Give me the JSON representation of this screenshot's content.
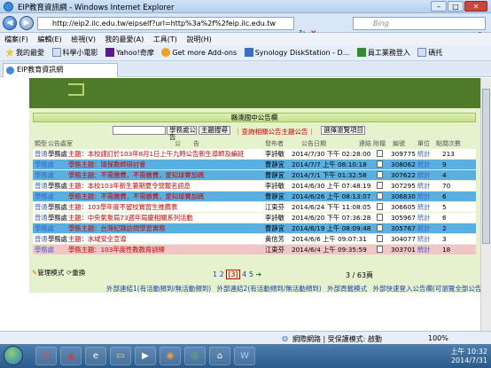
{
  "window": {
    "title": "EIP教育資訊網 - Windows Internet Explorer",
    "minimize": "–",
    "maximize": "□",
    "close": "✕"
  },
  "address": {
    "url": "http://eip2.ilc.edu.tw/eipself?url=http%3a%2f%2feip.ilc.edu.tw",
    "search_placeholder": "Bing"
  },
  "menu": [
    "檔案(F)",
    "編輯(E)",
    "檢視(V)",
    "我的最愛(A)",
    "工具(T)",
    "說明(H)"
  ],
  "favorites": [
    "我的最愛",
    "科學小電影",
    "Yahoo!奇摩",
    "Get more Add-ons",
    "Synology DiskStation - D...",
    "員工業務登入",
    "碼托"
  ],
  "tab": {
    "label": "EIP教育資訊網"
  },
  "board": {
    "title": "縣澳國中公告欄",
    "category_select": "學務處公告",
    "search_button": "主題搜尋",
    "important_link": "｜查詢相關公告主題公告｜",
    "view_select": "選擇瀏覽項目",
    "columns": {
      "type": "類型",
      "unit": "公告處室",
      "subject": "公　　告",
      "publisher": "發布者",
      "date": "公告日期",
      "link": "連結",
      "attach": "附檔",
      "code": "編號",
      "unit2": "單位",
      "clicks": "點閱次數"
    }
  },
  "rows": [
    {
      "type": "普通",
      "unit": "學務處",
      "subject": "主題：本校謹訂於103年8月1日上午九時公告新生導師及編班",
      "publisher": "李詩敏",
      "date": "2014/7/30 下午 02:28:00",
      "code": "309775",
      "stat": "統計",
      "clicks": "213",
      "style": "white"
    },
    {
      "type": "學務處",
      "unit": "",
      "subject": "學務主題：環保教師研討會",
      "publisher": "曹靜宜",
      "date": "2014/7/7 上午 08:10:18",
      "code": "308062",
      "stat": "統計",
      "clicks": "9",
      "style": "blue"
    },
    {
      "type": "學務處",
      "unit": "",
      "subject": "學務主題：不需繳費，不需繳費，愛知球賽加碼",
      "publisher": "曹靜宜",
      "date": "2014/7/1 下午 01:32:58",
      "code": "307622",
      "stat": "統計",
      "clicks": "4",
      "style": "blue"
    },
    {
      "type": "普通",
      "unit": "學務處",
      "subject": "主題：本校103年新生暑期夏令營報名訊息",
      "publisher": "李詩敏",
      "date": "2014/6/30 上午 07:48:19",
      "code": "307295",
      "stat": "統計",
      "clicks": "70",
      "style": "white"
    },
    {
      "type": "學務處",
      "unit": "",
      "subject": "學務主題：不需繳費，不需繳費，愛知球賽加碼",
      "publisher": "曹靜宜",
      "date": "2014/6/26 上午 08:13:07",
      "code": "306830",
      "stat": "統計",
      "clicks": "6",
      "style": "blue"
    },
    {
      "type": "普通",
      "unit": "學務處",
      "subject": "主題：103學年度不留校實習生推薦表",
      "publisher": "江東芬",
      "date": "2014/6/24 下午 11:08:05",
      "code": "306605",
      "stat": "統計",
      "clicks": "5",
      "style": "white"
    },
    {
      "type": "普通",
      "unit": "學務處",
      "subject": "主題：中央氣象局73週年局慶相關系列活動",
      "publisher": "李詩敏",
      "date": "2014/6/20 下午 07:36:28",
      "code": "305967",
      "stat": "統計",
      "clicks": "6",
      "style": "white"
    },
    {
      "type": "學務處",
      "unit": "",
      "subject": "學務主題：台灣紀錄訪問學習實務",
      "publisher": "曹靜宜",
      "date": "2014/6/19 上午 08:09:48",
      "code": "305767",
      "stat": "統計",
      "clicks": "2",
      "style": "blue"
    },
    {
      "type": "普通",
      "unit": "學務處",
      "subject": "主題：水域安全宣導",
      "publisher": "黃信芳",
      "date": "2014/6/6 上午 09:07:31",
      "code": "304077",
      "stat": "統計",
      "clicks": "3",
      "style": "white"
    },
    {
      "type": "學務處",
      "unit": "",
      "subject": "學務主題：103年度性教教育訓練",
      "publisher": "江東芬",
      "date": "2014/6/4 上午 09:35:59",
      "code": "303701",
      "stat": "統計",
      "clicks": "18",
      "style": "pink"
    }
  ],
  "pager": {
    "pages": [
      "1",
      "2",
      "[3]",
      "4",
      "5"
    ],
    "total": "3 / 63頁",
    "manage": "管理模式",
    "update": "重換"
  },
  "footer": {
    "links": [
      "外部連結1(有活動頻到/無活動頻到)",
      "外部連結2(有活動頻到/無活動頻到)",
      "外部頁籤模式",
      "外部快速登入公告欄(可瀏覽全部公告)"
    ]
  },
  "status": {
    "zone": "網際網路 | 受保護模式: 啟動",
    "zoom": "100%"
  },
  "taskbar": {
    "time": "上午 10:32",
    "date": "2014/7/31"
  }
}
